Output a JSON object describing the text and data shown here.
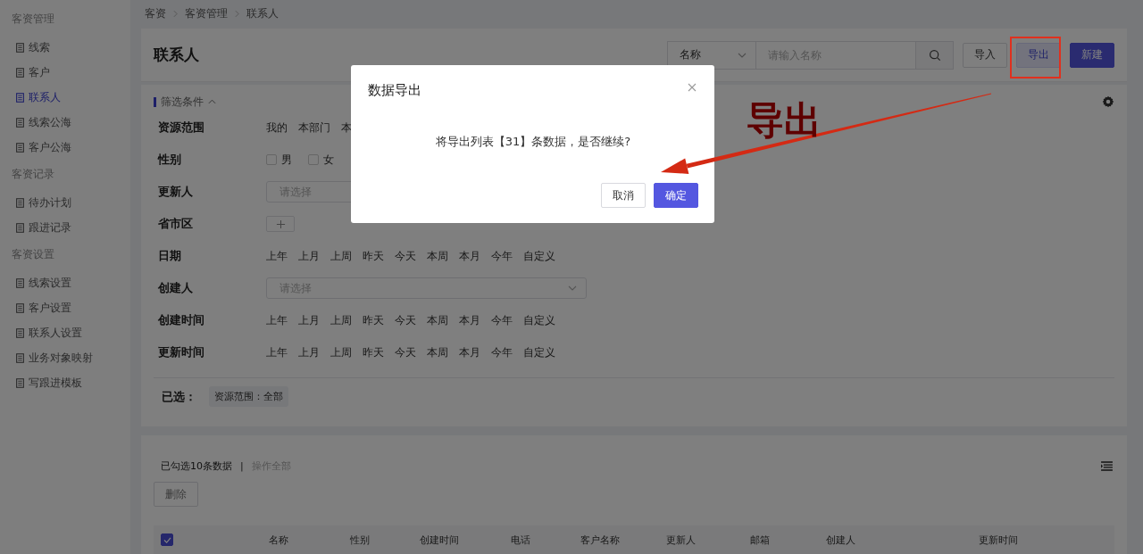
{
  "sidebar": [
    {
      "title": "客资管理",
      "items": [
        {
          "label": "线索",
          "selected": false
        },
        {
          "label": "客户",
          "selected": false
        },
        {
          "label": "联系人",
          "selected": true
        },
        {
          "label": "线索公海",
          "selected": false
        },
        {
          "label": "客户公海",
          "selected": false
        }
      ]
    },
    {
      "title": "客资记录",
      "items": [
        {
          "label": "待办计划",
          "selected": false
        },
        {
          "label": "跟进记录",
          "selected": false
        }
      ]
    },
    {
      "title": "客资设置",
      "items": [
        {
          "label": "线索设置",
          "selected": false
        },
        {
          "label": "客户设置",
          "selected": false
        },
        {
          "label": "联系人设置",
          "selected": false
        },
        {
          "label": "业务对象映射",
          "selected": false
        },
        {
          "label": "写跟进模板",
          "selected": false
        }
      ]
    }
  ],
  "breadcrumb": [
    "客资",
    "客资管理",
    "联系人"
  ],
  "header": {
    "title": "联系人",
    "search": {
      "field": "名称",
      "placeholder": "请输入名称"
    },
    "buttons": [
      {
        "label": "导入",
        "kind": "default"
      },
      {
        "label": "导出",
        "kind": "highlight"
      },
      {
        "label": "新建",
        "kind": "primary"
      }
    ]
  },
  "filters": {
    "title": "筛选条件",
    "expanded": true,
    "rows": [
      {
        "label": "资源范围",
        "kind": "options",
        "options": [
          "我的",
          "本部门",
          "本"
        ]
      },
      {
        "label": "性别",
        "kind": "checkboxes",
        "items": [
          {
            "label": "男",
            "checked": false
          },
          {
            "label": "女",
            "checked": false
          }
        ]
      },
      {
        "label": "更新人",
        "kind": "select",
        "placeholder": "请选择"
      },
      {
        "label": "省市区",
        "kind": "add"
      },
      {
        "label": "日期",
        "kind": "options",
        "options": [
          "上年",
          "上月",
          "上周",
          "昨天",
          "今天",
          "本周",
          "本月",
          "今年",
          "自定义"
        ]
      },
      {
        "label": "创建人",
        "kind": "select",
        "placeholder": "请选择",
        "chevron": true
      },
      {
        "label": "创建时间",
        "kind": "options",
        "options": [
          "上年",
          "上月",
          "上周",
          "昨天",
          "今天",
          "本周",
          "本月",
          "今年",
          "自定义"
        ]
      },
      {
        "label": "更新时间",
        "kind": "options",
        "options": [
          "上年",
          "上月",
          "上周",
          "昨天",
          "今天",
          "本周",
          "本月",
          "今年",
          "自定义"
        ]
      }
    ],
    "selected_label": "已选：",
    "selected_tags": [
      "资源范围：全部"
    ]
  },
  "table": {
    "selection_info": "已勾选10条数据",
    "separator": "|",
    "action": "操作全部",
    "buttons": [
      "删除"
    ],
    "header_checked": true,
    "columns": [
      "名称",
      "性别",
      "创建时间",
      "电话",
      "客户名称",
      "更新人",
      "邮箱",
      "创建人",
      "更新时间"
    ]
  },
  "dialog": {
    "title": "数据导出",
    "message": "将导出列表【31】条数据，是否继续?",
    "buttons": [
      {
        "label": "取消",
        "kind": "default"
      },
      {
        "label": "确定",
        "kind": "primary"
      }
    ]
  },
  "annotation": {
    "label": "导出"
  }
}
